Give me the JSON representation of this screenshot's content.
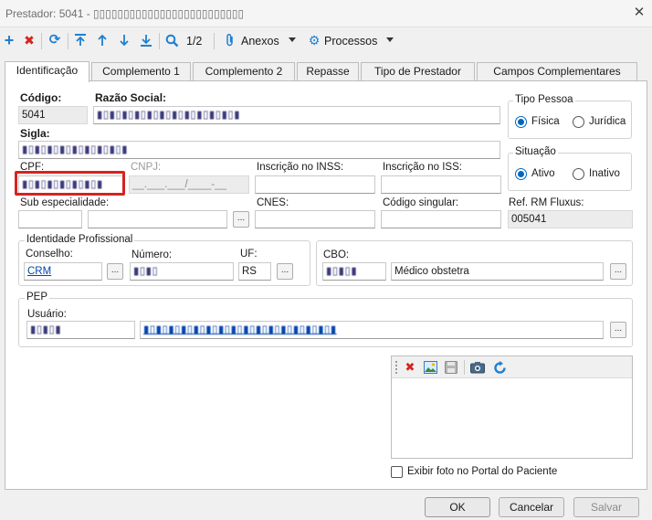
{
  "window": {
    "title": "Prestador: 5041 - ▯▯▯▯▯▯▯▯▯▯▯▯▯▯▯▯▯▯▯▯▯▯▯▯▯",
    "close_glyph": "✕"
  },
  "toolbar": {
    "page_indicator": "1/2",
    "anexos_label": "Anexos",
    "processos_label": "Processos",
    "icons": [
      "add-icon",
      "delete-icon",
      "refresh-icon",
      "first-icon",
      "previous-icon",
      "next-icon",
      "last-icon",
      "search-icon",
      "paperclip-icon",
      "gear-icon"
    ]
  },
  "tabs": [
    {
      "label": "Identificação",
      "active": true
    },
    {
      "label": "Complemento 1"
    },
    {
      "label": "Complemento 2"
    },
    {
      "label": "Repasse"
    },
    {
      "label": "Tipo de Prestador"
    },
    {
      "label": "Campos Complementares"
    }
  ],
  "form": {
    "codigo_label": "Código:",
    "codigo_value": "5041",
    "razao_label": "Razão Social:",
    "razao_value": "▮▯▮▯▮▯▮▯▮▯▮▯▮▯▮▯▮▯▮▯▮▯▮",
    "sigla_label": "Sigla:",
    "sigla_value": "▮▯▮▯▮▯▮▯▮▯▮▯▮▯▮▯▮",
    "cpf_label": "CPF:",
    "cpf_value": "▮▯▮▯▮▯▮▯▮▯▮▯▮",
    "cnpj_label": "CNPJ:",
    "cnpj_value": "__.___.___/____-__",
    "inss_label": "Inscrição no INSS:",
    "iss_label": "Inscrição no ISS:",
    "sub_esp_label": "Sub especialidade:",
    "cnes_label": "CNES:",
    "codigo_singular_label": "Código singular:",
    "ref_rm_label": "Ref. RM Fluxus:",
    "ref_rm_value": "005041",
    "ellipsis": "..."
  },
  "tipo_pessoa": {
    "title": "Tipo Pessoa",
    "options": [
      {
        "label": "Física",
        "selected": true
      },
      {
        "label": "Jurídica",
        "selected": false
      }
    ]
  },
  "situacao": {
    "title": "Situação",
    "options": [
      {
        "label": "Ativo",
        "selected": true
      },
      {
        "label": "Inativo",
        "selected": false
      }
    ]
  },
  "identidade": {
    "title": "Identidade Profissional",
    "conselho_label": "Conselho:",
    "conselho_value": "CRM",
    "numero_label": "Número:",
    "numero_value": "▮▯▮▯",
    "uf_label": "UF:",
    "uf_value": "RS"
  },
  "cbo": {
    "label": "CBO:",
    "code_value": "▮▯▮▯▮",
    "description_value": "Médico obstetra"
  },
  "pep": {
    "title": "PEP",
    "usuario_label": "Usuário:",
    "usuario_code": "▮▯▮▯▮",
    "usuario_name": "▮▯▮▯▮▯▮▯▮▯▮▯▮▯▮▯▮▯▮▯▮▯▮▯▮▯▮▯▮▯▮"
  },
  "photo": {
    "icons": [
      "delete-photo-icon",
      "image-icon",
      "save-photo-icon",
      "camera-icon",
      "rotate-icon"
    ],
    "portal_checkbox_label": "Exibir foto no Portal do Paciente",
    "portal_checked": false
  },
  "buttons": {
    "ok": "OK",
    "cancelar": "Cancelar",
    "salvar": "Salvar"
  },
  "colors": {
    "accent": "#0067c0",
    "highlight": "#d6231e",
    "link": "#0645ad",
    "add_icon": "#1f7fd1",
    "delete_icon": "#d6231e"
  }
}
